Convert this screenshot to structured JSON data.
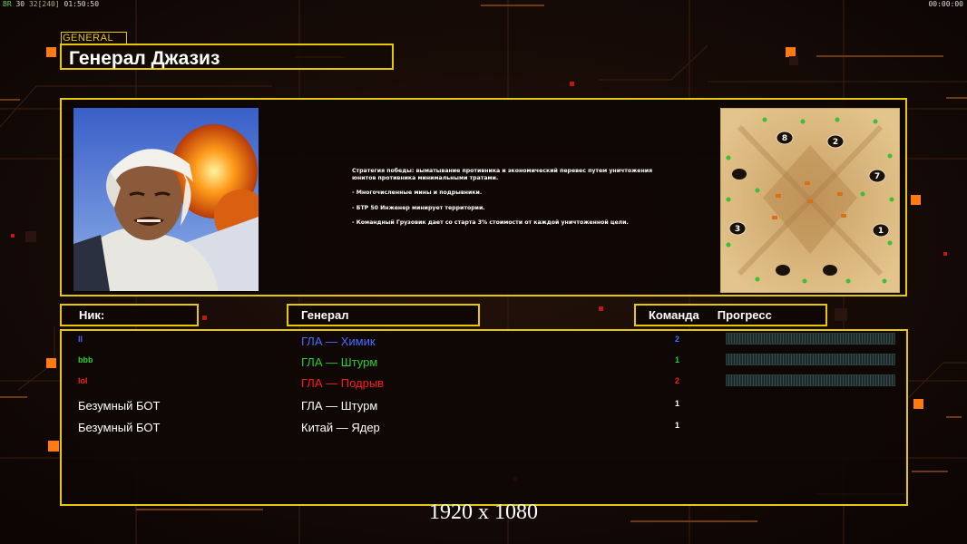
{
  "hud": {
    "left_prefix": "ВR",
    "left_a": "30",
    "left_b": "32",
    "left_c": "[240]",
    "left_time": "01:50:50",
    "right_time": "00:00:00"
  },
  "general": {
    "tag": "GENERAL",
    "name": "Генерал Джазиз"
  },
  "strategy": {
    "lines": [
      "Стратегия победы: выматывание противника и экономический перевес путем уничтожения юнитов противника минимальными тратами.",
      "- Многочисленные мины и подрывники.",
      "- БТР 50 Инженер минирует территории.",
      "- Командный Грузовик дает со старта 3% стоимости от каждой уничтоженной цели."
    ]
  },
  "minimap": {
    "start_positions": [
      "8",
      "2",
      "7",
      "3",
      "1"
    ]
  },
  "columns": {
    "nick": "Ник:",
    "general": "Генерал",
    "team": "Команда",
    "progress": "Прогресс"
  },
  "players": [
    {
      "nick": "ll",
      "general": "ГЛА — Химик",
      "team": "2",
      "color": "#4a6cff",
      "has_progress": true
    },
    {
      "nick": "bbb",
      "general": "ГЛА — Штурм",
      "team": "1",
      "color": "#2bd02b",
      "has_progress": true
    },
    {
      "nick": "lol",
      "general": "ГЛА — Подрыв",
      "team": "2",
      "color": "#ff1a1a",
      "has_progress": true
    },
    {
      "nick": "Безумный БОТ",
      "general": "ГЛА — Штурм",
      "team": "1",
      "color": "#ffffff",
      "has_progress": false
    },
    {
      "nick": "Безумный БОТ",
      "general": "Китай — Ядер",
      "team": "1",
      "color": "#ffffff",
      "has_progress": false
    }
  ],
  "resolution_label": "1920 x 1080"
}
